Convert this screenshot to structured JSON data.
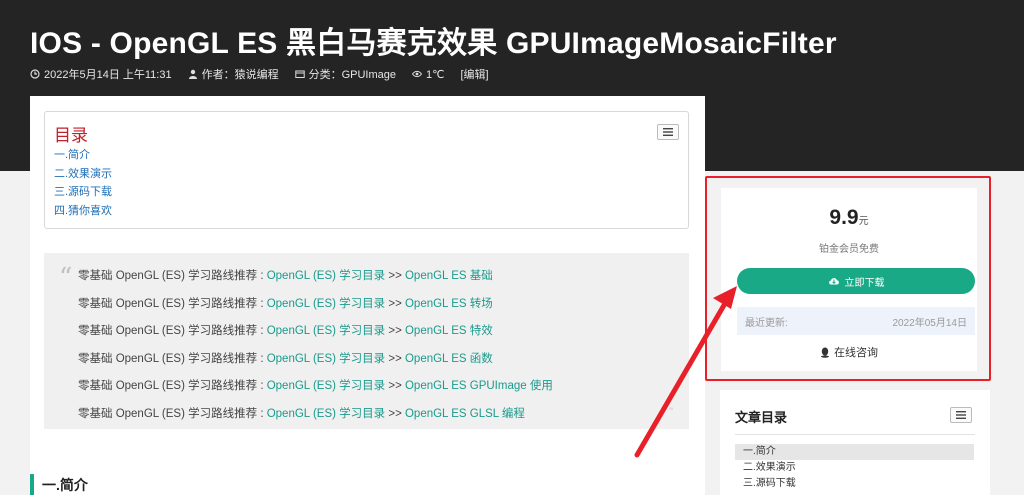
{
  "post": {
    "title": "IOS  -  OpenGL ES 黑白马赛克效果 GPUImageMosaicFilter",
    "meta": {
      "date": "2022年5月14日 上午11:31",
      "author": "作者：猿说编程",
      "category": "分类：GPUImage",
      "views": "1℃",
      "edit": "[编辑]"
    }
  },
  "toc": {
    "title": "目录",
    "items": [
      "一.简介",
      "二.效果演示",
      "三.源码下载",
      "四.猜你喜欢"
    ]
  },
  "quote": {
    "mark": "“",
    "end_mark": "”",
    "prefix": "零基础 OpenGL (ES) 学习路线推荐 : ",
    "link_main": "OpenGL (ES) 学习目录",
    "separator": " >> ",
    "rows": [
      "OpenGL ES 基础",
      "OpenGL ES 转场",
      "OpenGL ES 特效",
      "OpenGL ES 函数",
      "OpenGL ES GPUImage 使用",
      "OpenGL ES GLSL 编程"
    ]
  },
  "section": {
    "heading": "一.简介"
  },
  "purchase": {
    "price": "9.9",
    "unit": "元",
    "member_note": "铂金会员免费",
    "download_label": "立即下载",
    "updated_label": "最近更新:",
    "updated_date": "2022年05月14日",
    "consult_label": "在线咨询"
  },
  "sidebar_toc": {
    "title": "文章目录",
    "items": [
      "一.简介",
      "二.效果演示",
      "三.源码下载"
    ]
  },
  "colors": {
    "accent": "#19a986",
    "link": "#1a9a8c",
    "highlight": "#e8202a",
    "header_bg": "#242424"
  }
}
